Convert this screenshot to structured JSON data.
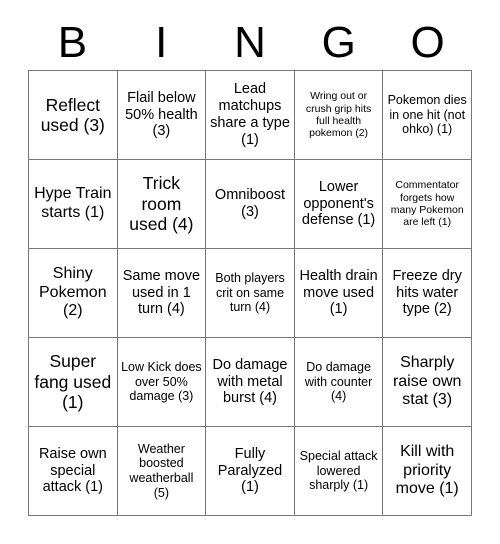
{
  "header": {
    "letters": [
      "B",
      "I",
      "N",
      "G",
      "O"
    ]
  },
  "grid": {
    "rows": 5,
    "columns": 5,
    "border_color": "#777777",
    "background_color": "#ffffff",
    "text_color": "#000000",
    "cells": [
      {
        "text": "Reflect used (3)",
        "size": "fs-xl"
      },
      {
        "text": "Flail below 50% health (3)",
        "size": "fs-md"
      },
      {
        "text": "Lead matchups share a type (1)",
        "size": "fs-md"
      },
      {
        "text": "Wring out or crush grip hits full health pokemon (2)",
        "size": "fs-xs"
      },
      {
        "text": "Pokemon dies in one hit (not ohko) (1)",
        "size": "fs-sm"
      },
      {
        "text": "Hype Train starts (1)",
        "size": "fs-lg"
      },
      {
        "text": "Trick room used (4)",
        "size": "fs-xl"
      },
      {
        "text": "Omniboost (3)",
        "size": "fs-md"
      },
      {
        "text": "Lower opponent's defense (1)",
        "size": "fs-md"
      },
      {
        "text": "Commentator forgets how many Pokemon are left (1)",
        "size": "fs-xs"
      },
      {
        "text": "Shiny Pokemon (2)",
        "size": "fs-lg"
      },
      {
        "text": "Same move used in 1 turn (4)",
        "size": "fs-md"
      },
      {
        "text": "Both players crit on same turn (4)",
        "size": "fs-sm"
      },
      {
        "text": "Health drain move used (1)",
        "size": "fs-md"
      },
      {
        "text": "Freeze dry hits water type (2)",
        "size": "fs-md"
      },
      {
        "text": "Super fang used (1)",
        "size": "fs-xl"
      },
      {
        "text": "Low Kick does over 50% damage (3)",
        "size": "fs-sm"
      },
      {
        "text": "Do damage with metal burst (4)",
        "size": "fs-md"
      },
      {
        "text": "Do damage with counter (4)",
        "size": "fs-sm"
      },
      {
        "text": "Sharply raise own stat (3)",
        "size": "fs-lg"
      },
      {
        "text": "Raise own special attack (1)",
        "size": "fs-md"
      },
      {
        "text": "Weather boosted weatherball (5)",
        "size": "fs-sm"
      },
      {
        "text": "Fully Paralyzed (1)",
        "size": "fs-md"
      },
      {
        "text": "Special attack lowered sharply (1)",
        "size": "fs-sm"
      },
      {
        "text": "Kill with priority move (1)",
        "size": "fs-lg"
      }
    ]
  }
}
